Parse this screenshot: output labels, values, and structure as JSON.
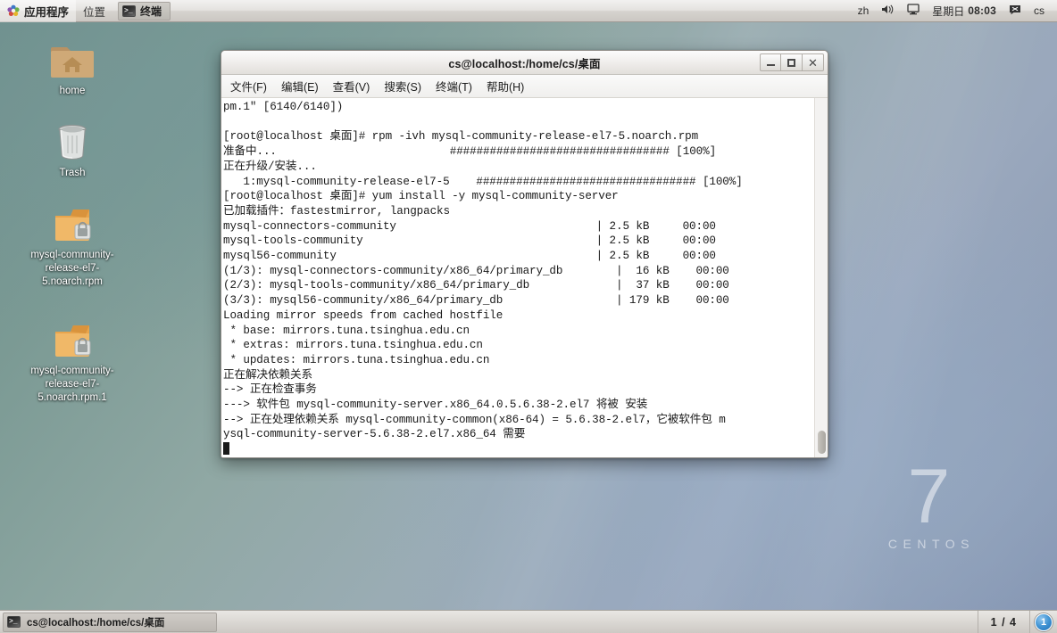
{
  "top_panel": {
    "applications_label": "应用程序",
    "places_label": "位置",
    "window_task_label": "终端",
    "applications_icon": "flower-menu-icon",
    "input_method": "zh",
    "volume_icon": "speaker-icon",
    "display_icon": "monitor-icon",
    "day_label": "星期日",
    "clock": "08:03",
    "message_icon": "message-icon",
    "user_label": "cs"
  },
  "desktop": {
    "icons": [
      {
        "name": "home",
        "label": "home",
        "icon": "home-folder-icon"
      },
      {
        "name": "trash",
        "label": "Trash",
        "icon": "trash-icon"
      },
      {
        "name": "rpm-1",
        "label": "mysql-community-release-el7-5.noarch.rpm",
        "icon": "rpm-package-icon"
      },
      {
        "name": "rpm-2",
        "label": "mysql-community-release-el7-5.noarch.rpm.1",
        "icon": "rpm-package-icon"
      }
    ],
    "watermark_number": "7",
    "watermark_word": "CENTOS"
  },
  "terminal": {
    "title": "cs@localhost:/home/cs/桌面",
    "menus": [
      {
        "name": "file",
        "label": "文件(F)"
      },
      {
        "name": "edit",
        "label": "编辑(E)"
      },
      {
        "name": "view",
        "label": "查看(V)"
      },
      {
        "name": "search",
        "label": "搜索(S)"
      },
      {
        "name": "terminal",
        "label": "终端(T)"
      },
      {
        "name": "help",
        "label": "帮助(H)"
      }
    ],
    "controls": {
      "minimize": "minimize-icon",
      "maximize": "maximize-icon",
      "close": "close-icon"
    },
    "output": "pm.1\" [6140/6140])\n\n[root@localhost 桌面]# rpm -ivh mysql-community-release-el7-5.noarch.rpm\n准备中...                          ################################# [100%]\n正在升级/安装...\n   1:mysql-community-release-el7-5    ################################# [100%]\n[root@localhost 桌面]# yum install -y mysql-community-server\n已加载插件：fastestmirror, langpacks\nmysql-connectors-community                              | 2.5 kB     00:00\nmysql-tools-community                                   | 2.5 kB     00:00\nmysql56-community                                       | 2.5 kB     00:00\n(1/3): mysql-connectors-community/x86_64/primary_db        |  16 kB    00:00\n(2/3): mysql-tools-community/x86_64/primary_db             |  37 kB    00:00\n(3/3): mysql56-community/x86_64/primary_db                 | 179 kB    00:00\nLoading mirror speeds from cached hostfile\n * base: mirrors.tuna.tsinghua.edu.cn\n * extras: mirrors.tuna.tsinghua.edu.cn\n * updates: mirrors.tuna.tsinghua.edu.cn\n正在解决依赖关系\n--> 正在检查事务\n---> 软件包 mysql-community-server.x86_64.0.5.6.38-2.el7 将被 安装\n--> 正在处理依赖关系 mysql-community-common(x86-64) = 5.6.38-2.el7，它被软件包 m\nysql-community-server-5.6.38-2.el7.x86_64 需要\n"
  },
  "bottom_panel": {
    "task_label": "cs@localhost:/home/cs/桌面",
    "task_icon": "terminal-icon",
    "pager_label": "1 / 4",
    "workspace_current": "1"
  }
}
